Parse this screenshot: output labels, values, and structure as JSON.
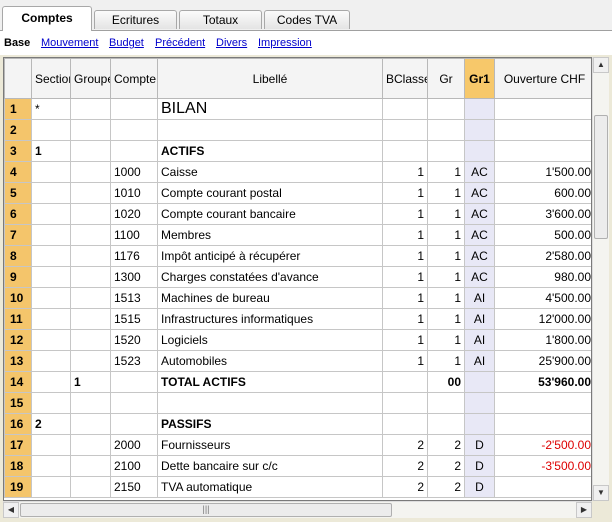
{
  "tabs": [
    {
      "label": "Comptes",
      "active": true
    },
    {
      "label": "Ecritures",
      "active": false
    },
    {
      "label": "Totaux",
      "active": false
    },
    {
      "label": "Codes TVA",
      "active": false
    }
  ],
  "views": {
    "current": "Base",
    "links": [
      "Mouvement",
      "Budget",
      "Précédent",
      "Divers",
      "Impression"
    ]
  },
  "columns": {
    "section": "Section",
    "groupe": "Groupe",
    "compte": "Compte",
    "libelle": "Libellé",
    "bclasse": "BClasse",
    "gr": "Gr",
    "gr1": "Gr1",
    "ouverture": "Ouverture CHF"
  },
  "rows": [
    {
      "n": "1",
      "section": "*",
      "groupe": "",
      "compte": "",
      "libelle": "BILAN",
      "bclasse": "",
      "gr": "",
      "gr1": "",
      "ouverture": ""
    },
    {
      "n": "2",
      "section": "",
      "groupe": "",
      "compte": "",
      "libelle": "",
      "bclasse": "",
      "gr": "",
      "gr1": "",
      "ouverture": ""
    },
    {
      "n": "3",
      "section": "1",
      "groupe": "",
      "compte": "",
      "libelle": "ACTIFS",
      "bclasse": "",
      "gr": "",
      "gr1": "",
      "ouverture": ""
    },
    {
      "n": "4",
      "section": "",
      "groupe": "",
      "compte": "1000",
      "libelle": "Caisse",
      "bclasse": "1",
      "gr": "1",
      "gr1": "AC",
      "ouverture": "1'500.00"
    },
    {
      "n": "5",
      "section": "",
      "groupe": "",
      "compte": "1010",
      "libelle": "Compte courant postal",
      "bclasse": "1",
      "gr": "1",
      "gr1": "AC",
      "ouverture": "600.00"
    },
    {
      "n": "6",
      "section": "",
      "groupe": "",
      "compte": "1020",
      "libelle": "Compte courant bancaire",
      "bclasse": "1",
      "gr": "1",
      "gr1": "AC",
      "ouverture": "3'600.00"
    },
    {
      "n": "7",
      "section": "",
      "groupe": "",
      "compte": "1100",
      "libelle": "Membres",
      "bclasse": "1",
      "gr": "1",
      "gr1": "AC",
      "ouverture": "500.00"
    },
    {
      "n": "8",
      "section": "",
      "groupe": "",
      "compte": "1176",
      "libelle": "Impôt anticipé à récupérer",
      "bclasse": "1",
      "gr": "1",
      "gr1": "AC",
      "ouverture": "2'580.00"
    },
    {
      "n": "9",
      "section": "",
      "groupe": "",
      "compte": "1300",
      "libelle": "Charges constatées d'avance",
      "bclasse": "1",
      "gr": "1",
      "gr1": "AC",
      "ouverture": "980.00"
    },
    {
      "n": "10",
      "section": "",
      "groupe": "",
      "compte": "1513",
      "libelle": "Machines de bureau",
      "bclasse": "1",
      "gr": "1",
      "gr1": "AI",
      "ouverture": "4'500.00"
    },
    {
      "n": "11",
      "section": "",
      "groupe": "",
      "compte": "1515",
      "libelle": "Infrastructures informatiques",
      "bclasse": "1",
      "gr": "1",
      "gr1": "AI",
      "ouverture": "12'000.00"
    },
    {
      "n": "12",
      "section": "",
      "groupe": "",
      "compte": "1520",
      "libelle": "Logiciels",
      "bclasse": "1",
      "gr": "1",
      "gr1": "AI",
      "ouverture": "1'800.00"
    },
    {
      "n": "13",
      "section": "",
      "groupe": "",
      "compte": "1523",
      "libelle": "Automobiles",
      "bclasse": "1",
      "gr": "1",
      "gr1": "AI",
      "ouverture": "25'900.00"
    },
    {
      "n": "14",
      "section": "",
      "groupe": "1",
      "compte": "",
      "libelle": "TOTAL ACTIFS",
      "bclasse": "",
      "gr": "00",
      "gr1": "",
      "ouverture": "53'960.00"
    },
    {
      "n": "15",
      "section": "",
      "groupe": "",
      "compte": "",
      "libelle": "",
      "bclasse": "",
      "gr": "",
      "gr1": "",
      "ouverture": ""
    },
    {
      "n": "16",
      "section": "2",
      "groupe": "",
      "compte": "",
      "libelle": "PASSIFS",
      "bclasse": "",
      "gr": "",
      "gr1": "",
      "ouverture": ""
    },
    {
      "n": "17",
      "section": "",
      "groupe": "",
      "compte": "2000",
      "libelle": "Fournisseurs",
      "bclasse": "2",
      "gr": "2",
      "gr1": "D",
      "ouverture": "-2'500.00"
    },
    {
      "n": "18",
      "section": "",
      "groupe": "",
      "compte": "2100",
      "libelle": "Dette bancaire sur c/c",
      "bclasse": "2",
      "gr": "2",
      "gr1": "D",
      "ouverture": "-3'500.00"
    },
    {
      "n": "19",
      "section": "",
      "groupe": "",
      "compte": "2150",
      "libelle": "TVA automatique",
      "bclasse": "2",
      "gr": "2",
      "gr1": "D",
      "ouverture": ""
    }
  ],
  "colors": {
    "negative": "#dd0000",
    "row_header": "#f4c56b",
    "gr1_column": "#e8e8f6"
  },
  "icons": {
    "scroll_up": "scroll-up-icon",
    "scroll_down": "scroll-down-icon",
    "scroll_left": "scroll-left-icon",
    "scroll_right": "scroll-right-icon"
  }
}
